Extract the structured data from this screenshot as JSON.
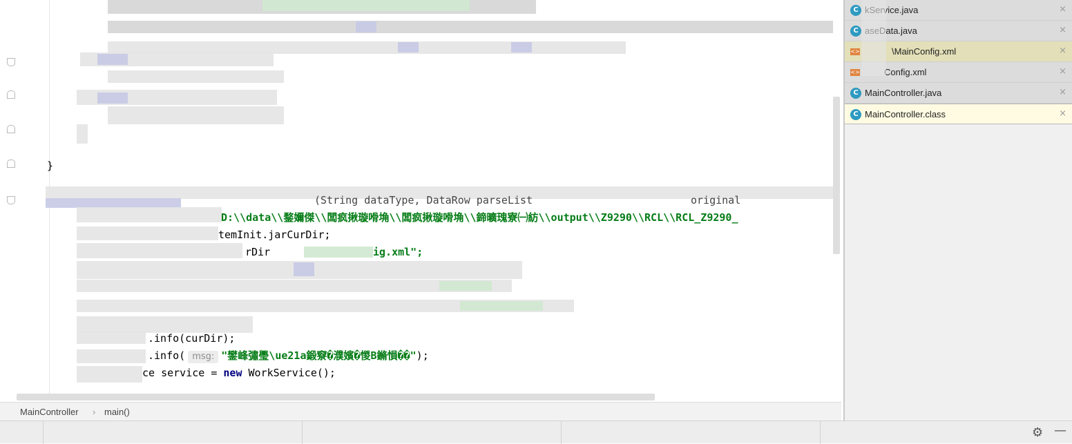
{
  "editor": {
    "closing_brace": "}",
    "lines": {
      "line_signature_tail": "(String dataType, DataRow parseList",
      "line_signature_end": "original",
      "line_path_prefix": "D:\\\\data\\\\",
      "line_path_body": "鍪嬭傑\\\\闆疯揪璇嗗埆\\\\闆疯揪璇嗗埆\\\\鍗曠瑰寮㈠紡\\\\output\\\\Z9290\\\\RCL\\\\RCL_Z9290_",
      "line_jar": "temInit.jarCurDir;",
      "line_rdir": "rDir",
      "line_xml": "ig.xml\";",
      "line_info_cur": ".info(curDir);",
      "line_info_msg_pre": ".info(",
      "line_info_hint": "msg:",
      "line_info_msg_str": "\"鐢峰彇璺\\ue21a鍛竂�濮嬪�惾B鏅愪��\"",
      "line_info_msg_end": ");",
      "line_service_pre": "ce service = ",
      "line_service_kw": "new",
      "line_service_post": " WorkService();"
    }
  },
  "breadcrumb": {
    "class_name": "MainController",
    "separator": "›",
    "method_name": "main()"
  },
  "tabs": [
    {
      "label": "kService.java",
      "icon": "java-class-icon",
      "type": "java"
    },
    {
      "label": "aseData.java",
      "icon": "java-class-icon",
      "type": "java"
    },
    {
      "label": "\\MainConfig.xml",
      "icon": "xml-file-icon",
      "type": "xml"
    },
    {
      "label": "Config.xml",
      "icon": "xml-file-icon",
      "type": "xml"
    },
    {
      "label": "MainController.java",
      "icon": "java-class-icon",
      "type": "java"
    },
    {
      "label": "MainController.class",
      "icon": "java-class-icon",
      "type": "java"
    }
  ],
  "tab_close_glyph": "×",
  "status": {
    "settings_icon": "gear-icon",
    "minimize_icon": "minimize-icon"
  }
}
